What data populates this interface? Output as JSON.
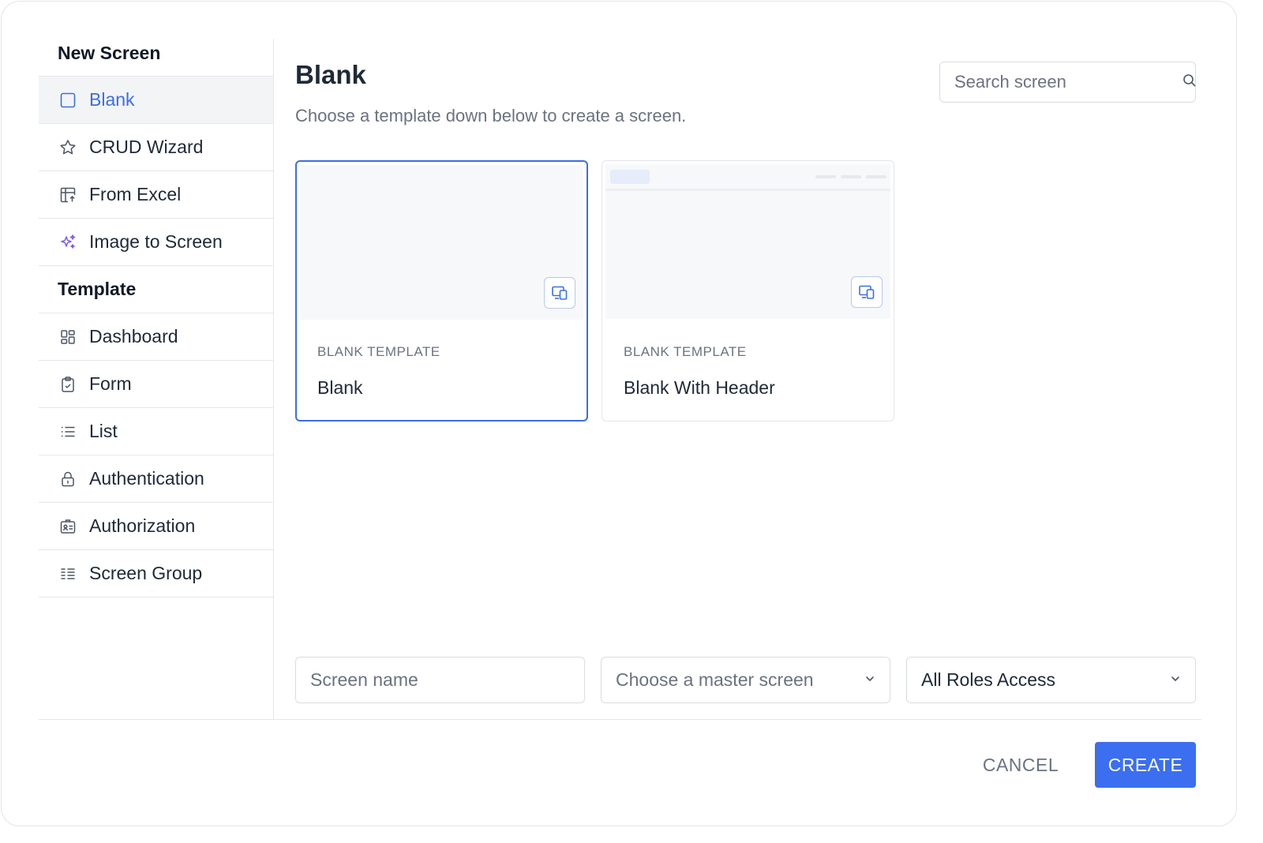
{
  "sidebar": {
    "new_screen_heading": "New Screen",
    "new_screen_items": [
      {
        "label": "Blank",
        "icon": "square-icon",
        "active": true
      },
      {
        "label": "CRUD Wizard",
        "icon": "star-icon"
      },
      {
        "label": "From Excel",
        "icon": "table-upload-icon"
      },
      {
        "label": "Image to Screen",
        "icon": "sparkles-icon"
      }
    ],
    "template_heading": "Template",
    "template_items": [
      {
        "label": "Dashboard",
        "icon": "dashboard-icon"
      },
      {
        "label": "Form",
        "icon": "clipboard-icon"
      },
      {
        "label": "List",
        "icon": "list-icon"
      },
      {
        "label": "Authentication",
        "icon": "lock-icon"
      },
      {
        "label": "Authorization",
        "icon": "id-card-icon"
      },
      {
        "label": "Screen Group",
        "icon": "grouped-list-icon"
      }
    ]
  },
  "main": {
    "title": "Blank",
    "subtitle": "Choose a template down below to create a screen.",
    "search": {
      "placeholder": "Search screen"
    },
    "cards": [
      {
        "kicker": "BLANK TEMPLATE",
        "title": "Blank",
        "selected": true
      },
      {
        "kicker": "BLANK TEMPLATE",
        "title": "Blank With Header",
        "selected": false
      }
    ]
  },
  "form": {
    "screen_name_placeholder": "Screen name",
    "master_screen_placeholder": "Choose a master screen",
    "roles_value": "All Roles Access"
  },
  "footer": {
    "cancel_label": "CANCEL",
    "create_label": "CREATE"
  },
  "colors": {
    "accent": "#3b6ff0",
    "active_text": "#3b6fe0",
    "sparkle": "#7c5cf0"
  }
}
